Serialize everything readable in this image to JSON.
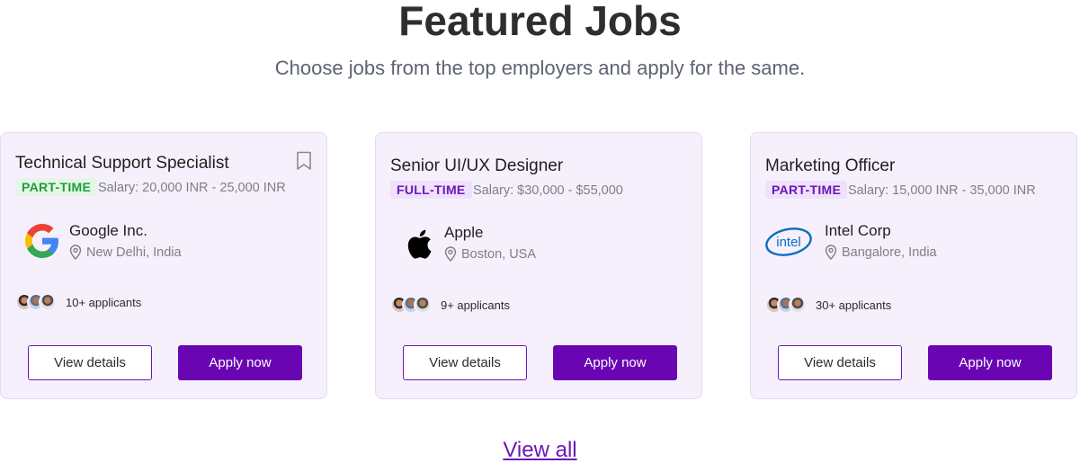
{
  "header": {
    "title": "Featured Jobs",
    "subtitle": "Choose jobs from the top employers and apply for the same."
  },
  "jobs": [
    {
      "title": "Technical Support Specialist",
      "type": "PART-TIME",
      "salary": "Salary: 20,000 INR - 25,000 INR",
      "company": "Google Inc.",
      "logo": "google-logo",
      "location": "New Delhi, India",
      "applicants": "10+ applicants",
      "bookmark": "bookmark-icon"
    },
    {
      "title": "Senior UI/UX Designer",
      "type": "FULL-TIME",
      "salary": "Salary: $30,000 - $55,000",
      "company": "Apple",
      "logo": "apple-logo",
      "location": "Boston, USA",
      "applicants": "9+ applicants"
    },
    {
      "title": "Marketing Officer",
      "type": "PART-TIME",
      "salary": "Salary: 15,000 INR - 35,000 INR",
      "company": "Intel Corp",
      "logo": "intel-logo",
      "location": "Bangalore, India",
      "applicants": "30+ applicants"
    }
  ],
  "buttons": {
    "view_details": "View details",
    "apply_now": "Apply now"
  },
  "footer": {
    "view_all": "View all"
  },
  "colors": {
    "primary": "#6a05b3",
    "card_bg": "#f6f0fc",
    "part_time_green": "#1f9d3a",
    "full_time_purple": "#6a18b8"
  }
}
